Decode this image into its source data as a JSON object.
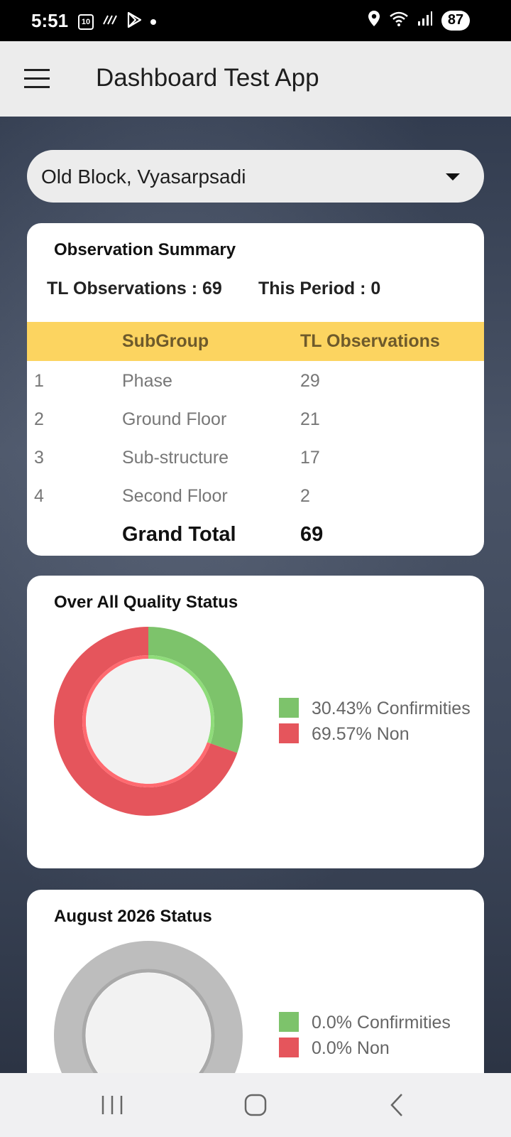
{
  "status_bar": {
    "time": "5:51",
    "calendar_day": "10",
    "battery": "87"
  },
  "app_bar": {
    "title": "Dashboard Test App"
  },
  "location_dropdown": {
    "selected": "Old Block, Vyasarpsadi"
  },
  "observation_summary": {
    "title": "Observation Summary",
    "tl_observations_label": "TL Observations :  69",
    "this_period_label": "This Period :  0",
    "columns": [
      "",
      "SubGroup",
      "TL Observations"
    ],
    "rows": [
      {
        "index": "1",
        "subgroup": "Phase",
        "count": "29"
      },
      {
        "index": "2",
        "subgroup": "Ground Floor",
        "count": "21"
      },
      {
        "index": "3",
        "subgroup": "Sub-structure",
        "count": "17"
      },
      {
        "index": "4",
        "subgroup": "Second Floor",
        "count": "2"
      }
    ],
    "grand_total_label": "Grand Total",
    "grand_total_value": "69"
  },
  "quality_status": {
    "title": "Over All Quality Status",
    "legend": [
      {
        "label": "30.43% Confirmities",
        "color": "#7dc36b"
      },
      {
        "label": "69.57% Non",
        "color": "#e5555c"
      }
    ]
  },
  "august_status": {
    "title": "August 2026 Status",
    "legend": [
      {
        "label": "0.0% Confirmities",
        "color": "#7dc36b"
      },
      {
        "label": "0.0% Non",
        "color": "#e5555c"
      }
    ]
  },
  "chart_data": [
    {
      "type": "pie",
      "title": "Over All Quality Status",
      "categories": [
        "Confirmities",
        "Non"
      ],
      "values": [
        30.43,
        69.57
      ],
      "colors": [
        "#7dc36b",
        "#e5555c"
      ],
      "legend": "right"
    },
    {
      "type": "pie",
      "title": "August 2026 Status",
      "categories": [
        "Confirmities",
        "Non"
      ],
      "values": [
        0.0,
        0.0
      ],
      "colors": [
        "#7dc36b",
        "#e5555c"
      ],
      "empty_color": "#bdbdbd",
      "legend": "right"
    }
  ]
}
